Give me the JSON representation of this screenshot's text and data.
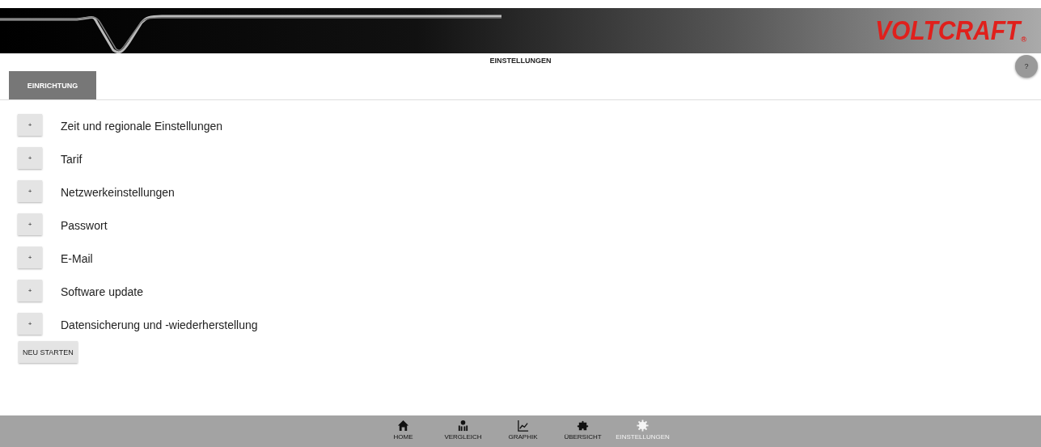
{
  "header": {
    "logo": "VOLTCRAFT",
    "logo_mark": "®"
  },
  "page_title": "EINSTELLUNGEN",
  "help_button": "?",
  "tabs": [
    {
      "label": "EINRICHTUNG",
      "selected": true
    }
  ],
  "sections": [
    {
      "toggle": "+",
      "label": "Zeit und regionale Einstellungen"
    },
    {
      "toggle": "+",
      "label": "Tarif"
    },
    {
      "toggle": "+",
      "label": "Netzwerkeinstellungen"
    },
    {
      "toggle": "+",
      "label": "Passwort"
    },
    {
      "toggle": "+",
      "label": "E-Mail"
    },
    {
      "toggle": "+",
      "label": "Software update"
    },
    {
      "toggle": "+",
      "label": "Datensicherung und -wiederherstellung"
    }
  ],
  "restart_button": "NEU STARTEN",
  "bottom_nav": [
    {
      "label": "HOME",
      "selected": false
    },
    {
      "label": "VERGLEICH",
      "selected": false
    },
    {
      "label": "GRAPHIK",
      "selected": false
    },
    {
      "label": "ÜBERSICHT",
      "selected": false
    },
    {
      "label": "EINSTELLUNGEN",
      "selected": true
    }
  ]
}
